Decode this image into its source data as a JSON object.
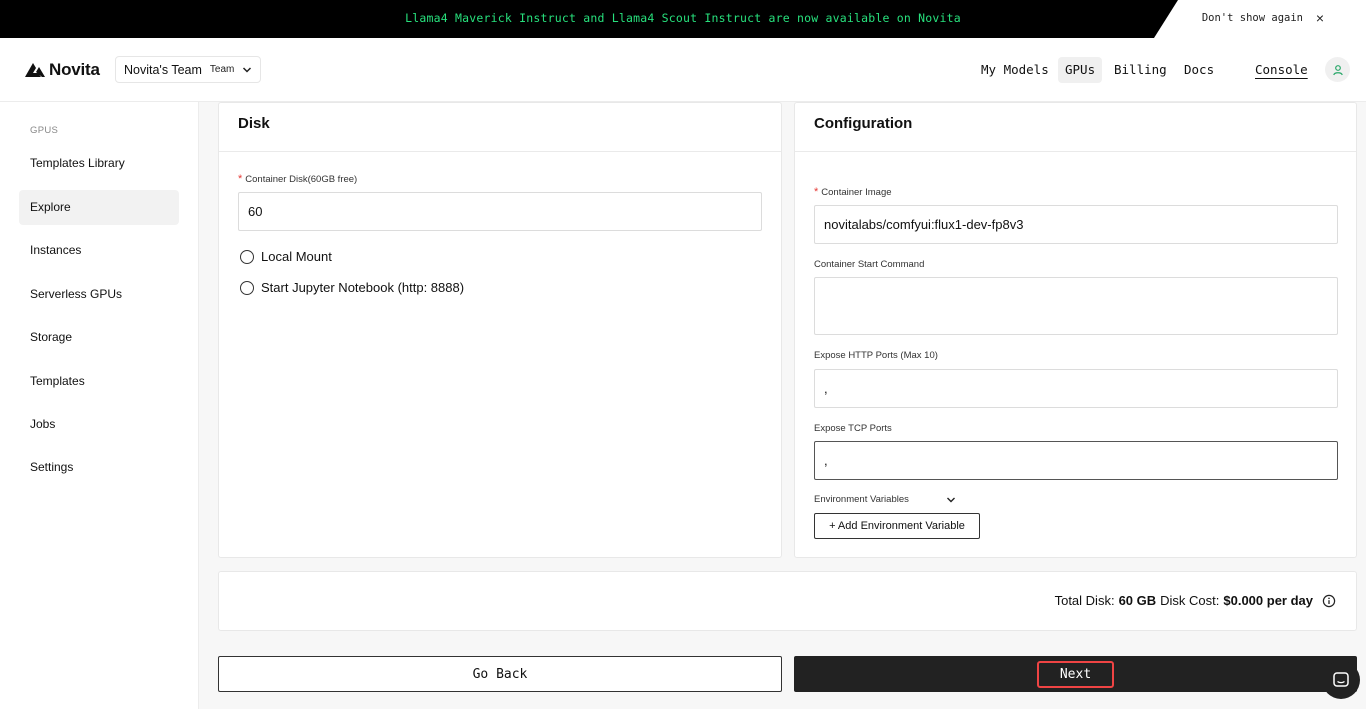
{
  "announcement": {
    "text": "Llama4 Maverick Instruct and Llama4 Scout Instruct are now available on Novita",
    "dont_show": "Don't show again",
    "close_glyph": "×"
  },
  "header": {
    "brand": "Novita",
    "team_name": "Novita's Team",
    "team_badge": "Team",
    "nav": {
      "my_models": "My Models",
      "gpus": "GPUs",
      "billing": "Billing",
      "docs": "Docs",
      "console": "Console"
    }
  },
  "sidebar": {
    "section": "GPUS",
    "items": [
      "Templates Library",
      "Explore",
      "Instances",
      "Serverless GPUs",
      "Storage",
      "Templates",
      "Jobs",
      "Settings"
    ],
    "active": "Explore"
  },
  "disk": {
    "title": "Disk",
    "container_disk_label": "Container Disk(60GB free)",
    "container_disk_value": "60",
    "local_mount": "Local Mount",
    "jupyter": "Start Jupyter Notebook (http: 8888)"
  },
  "configuration": {
    "title": "Configuration",
    "image_label": "Container Image",
    "image_value": "novitalabs/comfyui:flux1-dev-fp8v3",
    "start_cmd_label": "Container Start Command",
    "start_cmd_value": "",
    "http_ports_label": "Expose HTTP Ports (Max 10)",
    "http_ports_value": ",",
    "tcp_ports_label": "Expose TCP Ports",
    "tcp_ports_value": ",",
    "env_label": "Environment Variables",
    "add_env": "+ Add Environment Variable"
  },
  "summary": {
    "total_disk_label": "Total Disk:",
    "total_disk_value": "60 GB",
    "disk_cost_label": "Disk Cost:",
    "disk_cost_value": "$0.000 per day"
  },
  "actions": {
    "go_back": "Go Back",
    "next": "Next"
  },
  "colors": {
    "announce_text": "#27e07c",
    "required": "#e53935",
    "highlight": "#ef4444"
  }
}
